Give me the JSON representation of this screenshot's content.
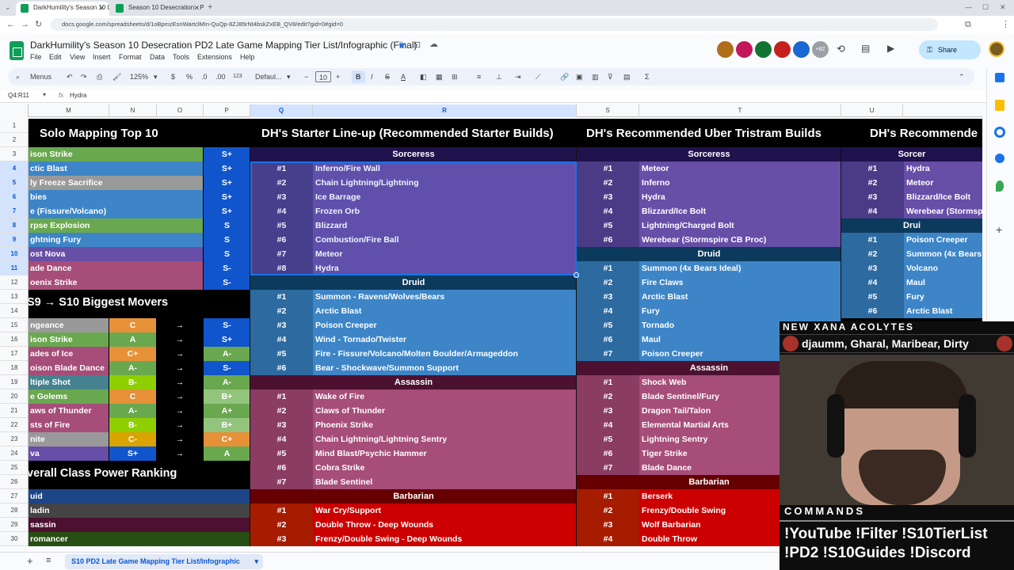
{
  "browser": {
    "tabs": [
      {
        "label": "DarkHumility's Season 10 Desc..."
      },
      {
        "label": "Season 10 Desecration - PD2 S..."
      }
    ],
    "url": "docs.google.com/spreadsheets/d/1oBpmzEsnWartclMIn-QuQp-8ZJ85rNt4bskZxEB_QV8/edit?gid=0#gid=0"
  },
  "doc": {
    "title": "DarkHumility's Season 10 Desecration PD2 Late Game Mapping Tier List/Infographic (Final)",
    "menus": [
      "File",
      "Edit",
      "View",
      "Insert",
      "Format",
      "Data",
      "Tools",
      "Extensions",
      "Help"
    ],
    "collab_count": "+82",
    "share_label": "Share"
  },
  "toolbar": {
    "menus_label": "Menus",
    "zoom": "125%",
    "currency": "$",
    "percent": "%",
    "dec_less": ".0",
    "dec_more": ".00",
    "number_format": "123",
    "font": "Defaul...",
    "font_size": "10",
    "bold": "B",
    "italic": "I",
    "strike": "S",
    "text_color": "A",
    "sum": "Σ"
  },
  "formula_bar": {
    "name_box": "Q4:R11",
    "fx": "fx",
    "content": "Hydra"
  },
  "columns": [
    "M",
    "N",
    "O",
    "P",
    "Q",
    "R",
    "S",
    "T",
    "U"
  ],
  "rows": [
    "1",
    "2",
    "3",
    "4",
    "5",
    "6",
    "7",
    "8",
    "9",
    "10",
    "11",
    "12",
    "13",
    "14",
    "15",
    "16",
    "17",
    "18",
    "19",
    "20",
    "21",
    "22",
    "23",
    "24",
    "25",
    "26",
    "27",
    "28",
    "29",
    "30"
  ],
  "sheet": {
    "solo_title": "Solo Mapping Top 10",
    "solo": [
      {
        "name": "ison Strike",
        "tier": "S+",
        "color": "#6aa84f"
      },
      {
        "name": "ctic Blast",
        "tier": "S+",
        "color": "#3d85c6"
      },
      {
        "name": "ly Freeze Sacrifice",
        "tier": "S+",
        "color": "#999999"
      },
      {
        "name": "bies",
        "tier": "S+",
        "color": "#3d85c6"
      },
      {
        "name": "e (Fissure/Volcano)",
        "tier": "S+",
        "color": "#3d85c6"
      },
      {
        "name": "rpse Explosion",
        "tier": "S",
        "color": "#6aa84f"
      },
      {
        "name": "ghtning Fury",
        "tier": "S",
        "color": "#3d85c6"
      },
      {
        "name": "ost Nova",
        "tier": "S",
        "color": "#674ea7"
      },
      {
        "name": "ade Dance",
        "tier": "S-",
        "color": "#a64d79"
      },
      {
        "name": "oenix Strike",
        "tier": "S-",
        "color": "#a64d79"
      }
    ],
    "movers_title": "S9 → S10 Biggest Movers",
    "movers": [
      {
        "name": "ngeance",
        "from": "C",
        "to": "S-",
        "color": "#999999"
      },
      {
        "name": "ison Strike",
        "from": "A",
        "to": "S+",
        "color": "#6aa84f"
      },
      {
        "name": "ades of Ice",
        "from": "C+",
        "to": "A-",
        "color": "#a64d79"
      },
      {
        "name": "oison Blade Dance",
        "from": "A-",
        "to": "S-",
        "color": "#a64d79"
      },
      {
        "name": "ltiple Shot",
        "from": "B-",
        "to": "A-",
        "color": "#45818e"
      },
      {
        "name": "e Golems",
        "from": "C",
        "to": "B+",
        "color": "#6aa84f"
      },
      {
        "name": "aws of Thunder",
        "from": "A-",
        "to": "A+",
        "color": "#a64d79"
      },
      {
        "name": "sts of Fire",
        "from": "B-",
        "to": "B+",
        "color": "#a64d79"
      },
      {
        "name": "nite",
        "from": "C-",
        "to": "C+",
        "color": "#999999"
      },
      {
        "name": "va",
        "from": "S+",
        "to": "A",
        "color": "#674ea7"
      }
    ],
    "arrow": "→",
    "power_title": "verall Class Power Ranking",
    "power": [
      {
        "name": "uid",
        "color": "#1c4587"
      },
      {
        "name": "ladin",
        "color": "#444444"
      },
      {
        "name": "sassin",
        "color": "#4c1130"
      },
      {
        "name": "romancer",
        "color": "#274e13"
      }
    ],
    "starter_title": "DH's Starter Line-up (Recommended Starter Builds)",
    "starter": [
      {
        "class": "Sorceress",
        "items": [
          {
            "n": "#1",
            "b": "Inferno/Fire Wall"
          },
          {
            "n": "#2",
            "b": "Chain Lightning/Lightning"
          },
          {
            "n": "#3",
            "b": "Ice Barrage"
          },
          {
            "n": "#4",
            "b": "Frozen Orb"
          },
          {
            "n": "#5",
            "b": "Blizzard"
          },
          {
            "n": "#6",
            "b": "Combustion/Fire Ball"
          },
          {
            "n": "#7",
            "b": "Meteor"
          },
          {
            "n": "#8",
            "b": "Hydra"
          }
        ]
      },
      {
        "class": "Druid",
        "items": [
          {
            "n": "#1",
            "b": "Summon - Ravens/Wolves/Bears"
          },
          {
            "n": "#2",
            "b": "Arctic Blast"
          },
          {
            "n": "#3",
            "b": "Poison Creeper"
          },
          {
            "n": "#4",
            "b": "Wind - Tornado/Twister"
          },
          {
            "n": "#5",
            "b": "Fire - Fissure/Volcano/Molten Boulder/Armageddon"
          },
          {
            "n": "#6",
            "b": "Bear - Shockwave/Summon Support"
          }
        ]
      },
      {
        "class": "Assassin",
        "items": [
          {
            "n": "#1",
            "b": "Wake of Fire"
          },
          {
            "n": "#2",
            "b": "Claws of Thunder"
          },
          {
            "n": "#3",
            "b": "Phoenix Strike"
          },
          {
            "n": "#4",
            "b": "Chain Lightning/Lightning Sentry"
          },
          {
            "n": "#5",
            "b": "Mind Blast/Psychic Hammer"
          },
          {
            "n": "#6",
            "b": "Cobra Strike"
          },
          {
            "n": "#7",
            "b": "Blade Sentinel"
          }
        ]
      },
      {
        "class": "Barbarian",
        "items": [
          {
            "n": "#1",
            "b": "War Cry/Support"
          },
          {
            "n": "#2",
            "b": "Double Throw - Deep Wounds"
          },
          {
            "n": "#3",
            "b": "Frenzy/Double Swing - Deep Wounds"
          }
        ]
      }
    ],
    "uber_title": "DH's Recommended Uber Tristram Builds",
    "uber": [
      {
        "class": "Sorceress",
        "items": [
          {
            "n": "#1",
            "b": "Meteor"
          },
          {
            "n": "#2",
            "b": "Inferno"
          },
          {
            "n": "#3",
            "b": "Hydra"
          },
          {
            "n": "#4",
            "b": "Blizzard/Ice Bolt"
          },
          {
            "n": "#5",
            "b": "Lightning/Charged Bolt"
          },
          {
            "n": "#6",
            "b": "Werebear (Stormspire CB Proc)"
          }
        ]
      },
      {
        "class": "Druid",
        "items": [
          {
            "n": "#1",
            "b": "Summon (4x Bears Ideal)"
          },
          {
            "n": "#2",
            "b": "Fire Claws"
          },
          {
            "n": "#3",
            "b": "Arctic Blast"
          },
          {
            "n": "#4",
            "b": "Fury"
          },
          {
            "n": "#5",
            "b": "Tornado"
          },
          {
            "n": "#6",
            "b": "Maul"
          },
          {
            "n": "#7",
            "b": "Poison Creeper"
          }
        ]
      },
      {
        "class": "Assassin",
        "items": [
          {
            "n": "#1",
            "b": "Shock Web"
          },
          {
            "n": "#2",
            "b": "Blade Sentinel/Fury"
          },
          {
            "n": "#3",
            "b": "Dragon Tail/Talon"
          },
          {
            "n": "#4",
            "b": "Elemental Martial Arts"
          },
          {
            "n": "#5",
            "b": "Lightning Sentry"
          },
          {
            "n": "#6",
            "b": "Tiger Strike"
          },
          {
            "n": "#7",
            "b": "Blade Dance"
          }
        ]
      },
      {
        "class": "Barbarian",
        "items": [
          {
            "n": "#1",
            "b": "Berserk"
          },
          {
            "n": "#2",
            "b": "Frenzy/Double Swing"
          },
          {
            "n": "#3",
            "b": "Wolf Barbarian"
          },
          {
            "n": "#4",
            "b": "Double Throw"
          }
        ]
      }
    ],
    "rec_title": "DH's Recommende",
    "rec": [
      {
        "class": "Sorcer",
        "items": [
          {
            "n": "#1",
            "b": "Hydra"
          },
          {
            "n": "#2",
            "b": "Meteor"
          },
          {
            "n": "#3",
            "b": "Blizzard/Ice Bolt"
          },
          {
            "n": "#4",
            "b": "Werebear (Stormsp"
          }
        ]
      },
      {
        "class": "Drui",
        "items": [
          {
            "n": "#1",
            "b": "Poison Creeper"
          },
          {
            "n": "#2",
            "b": "Summon (4x Bears"
          },
          {
            "n": "#3",
            "b": "Volcano"
          },
          {
            "n": "#4",
            "b": "Maul"
          },
          {
            "n": "#5",
            "b": "Fury"
          },
          {
            "n": "#6",
            "b": "Arctic Blast"
          }
        ]
      }
    ]
  },
  "colors": {
    "sorc_row": "#674ea7",
    "sorc_num": "#4b3a85",
    "druid_row": "#3d85c6",
    "druid_num": "#2c6aa0",
    "druid_hdr": "#0b3a5c",
    "assassin_row": "#a64d79",
    "assassin_num": "#8a3c63",
    "assassin_hdr": "#4c1130",
    "barb_row": "#cc0000",
    "barb_num": "#a61c00",
    "barb_hdr": "#660000",
    "sorc_hdr": "#20124d",
    "tier_splus": "#1155cc",
    "tier_a": "#6aa84f",
    "tier_c": "#f1c232",
    "selection": "#1a73e8"
  },
  "sheet_tab": "S10 PD2 Late Game Mapping Tier List/Infographic",
  "overlay": {
    "acolytes_title": "NEW XANA ACOLYTES",
    "acolytes_names": "djaumm, Gharal, Maribear, Dirty",
    "commands_title": "COMMANDS",
    "commands_line1": "!YouTube !Filter !S10TierList",
    "commands_line2": "!PD2 !S10Guides !Discord"
  }
}
